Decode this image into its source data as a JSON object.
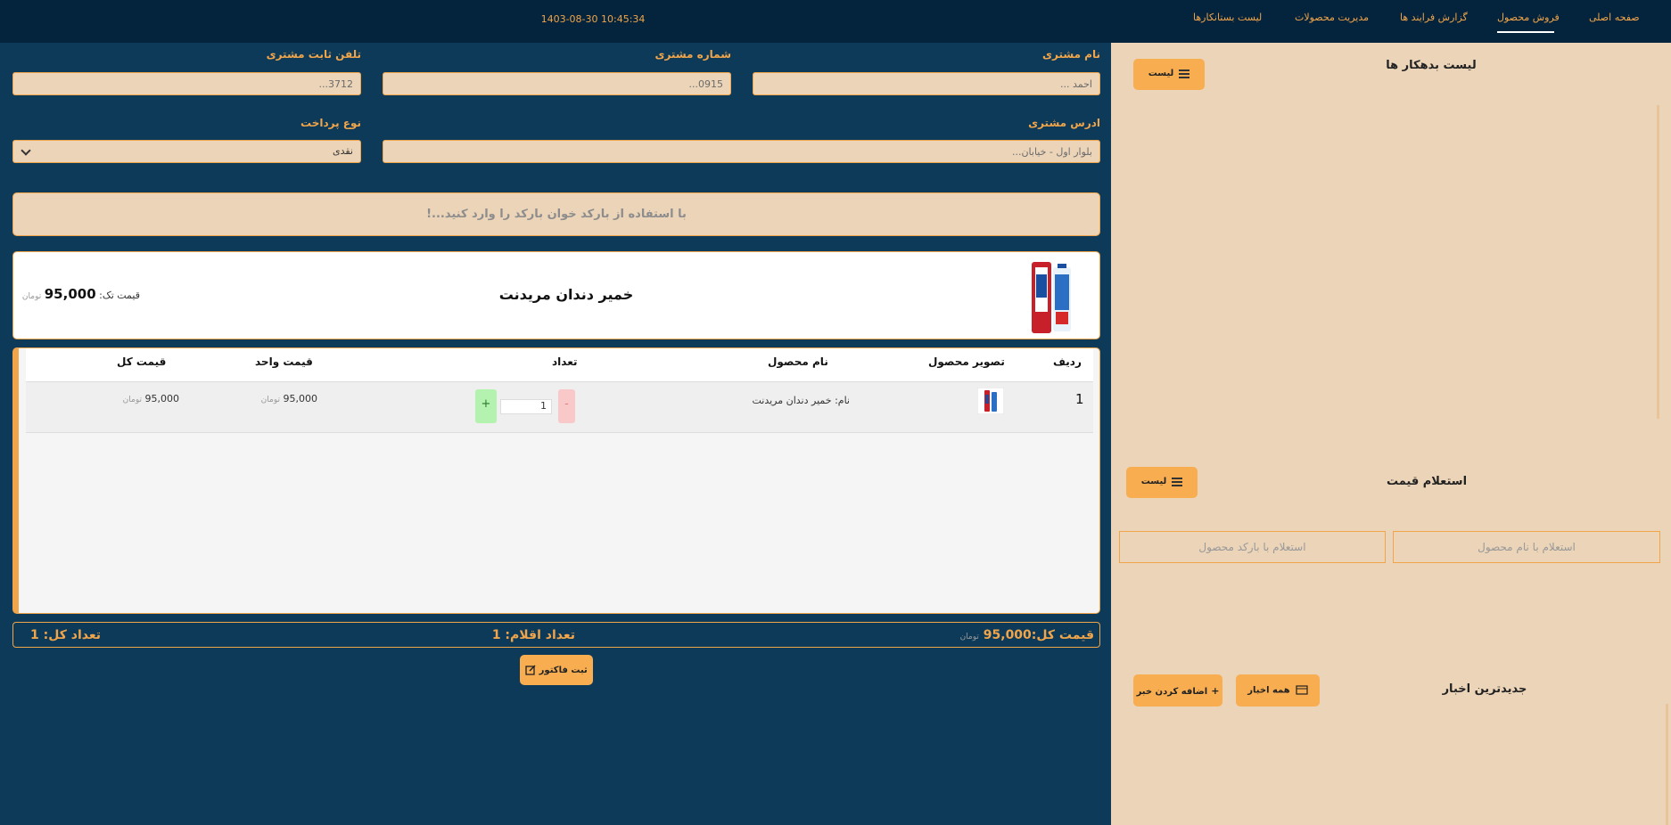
{
  "nav": {
    "items": [
      "صفحه اصلی",
      "فروش محصول",
      "گزارش فرایند ها",
      "مدیریت محصولات",
      "لیست بستانکارها"
    ],
    "datetime": "1403-08-30 10:45:34"
  },
  "form": {
    "customer_name_label": "نام مشتری",
    "customer_name_value": "احمد ...",
    "customer_number_label": "شماره مشتری",
    "customer_number_value": "0915...",
    "landline_label": "تلفن ثابت مشتری",
    "landline_value": "3712...",
    "address_label": "ادرس مشتری",
    "address_value": "بلوار اول - خیابان...",
    "payment_label": "نوع پرداخت",
    "payment_value": "نقدی",
    "barcode_placeholder": "با استفاده از بارکد خوان بارکد را وارد کنید...!"
  },
  "product_card": {
    "name": "خمیر دندان مریدنت",
    "price_label": "قیمت تک:",
    "price": "95,000",
    "currency": "تومان"
  },
  "cart": {
    "headers": [
      "ردیف",
      "تصویر محصول",
      "نام محصول",
      "تعداد",
      "قیمت واحد",
      "قیمت کل"
    ],
    "rows": [
      {
        "index": "1",
        "name_prefix": "نام:",
        "name": "خمیر دندان مریدنت",
        "qty": "1",
        "minus": "-",
        "plus": "+",
        "unit_price": "95,000",
        "total": "95,000",
        "currency": "تومان"
      }
    ]
  },
  "summary": {
    "total_label": "قیمت کل:",
    "total_value": "95,000",
    "currency": "تومان",
    "items_count": "تعداد اقلام: 1",
    "total_count": "تعداد کل: 1",
    "submit_label": "ثبت فاکتور"
  },
  "side": {
    "debtors_title": "لیست بدهکار ها",
    "list_button": "لیست",
    "price_inquiry_title": "استعلام قیمت",
    "inquiry_by_name": "استعلام با نام محصول",
    "inquiry_by_barcode": "استعلام با بارکد محصول",
    "news_title": "جدیدترین اخبار",
    "all_news_button": "همه اخبار",
    "add_news_button": "اضافه کردن خبر",
    "add_symbol": "+"
  },
  "colors": {
    "accent": "#f0a54a",
    "nav_bg": "#04233c",
    "main_bg": "#0e3a5a",
    "panel_bg": "#ecd4b8",
    "button": "#f7ad50"
  }
}
